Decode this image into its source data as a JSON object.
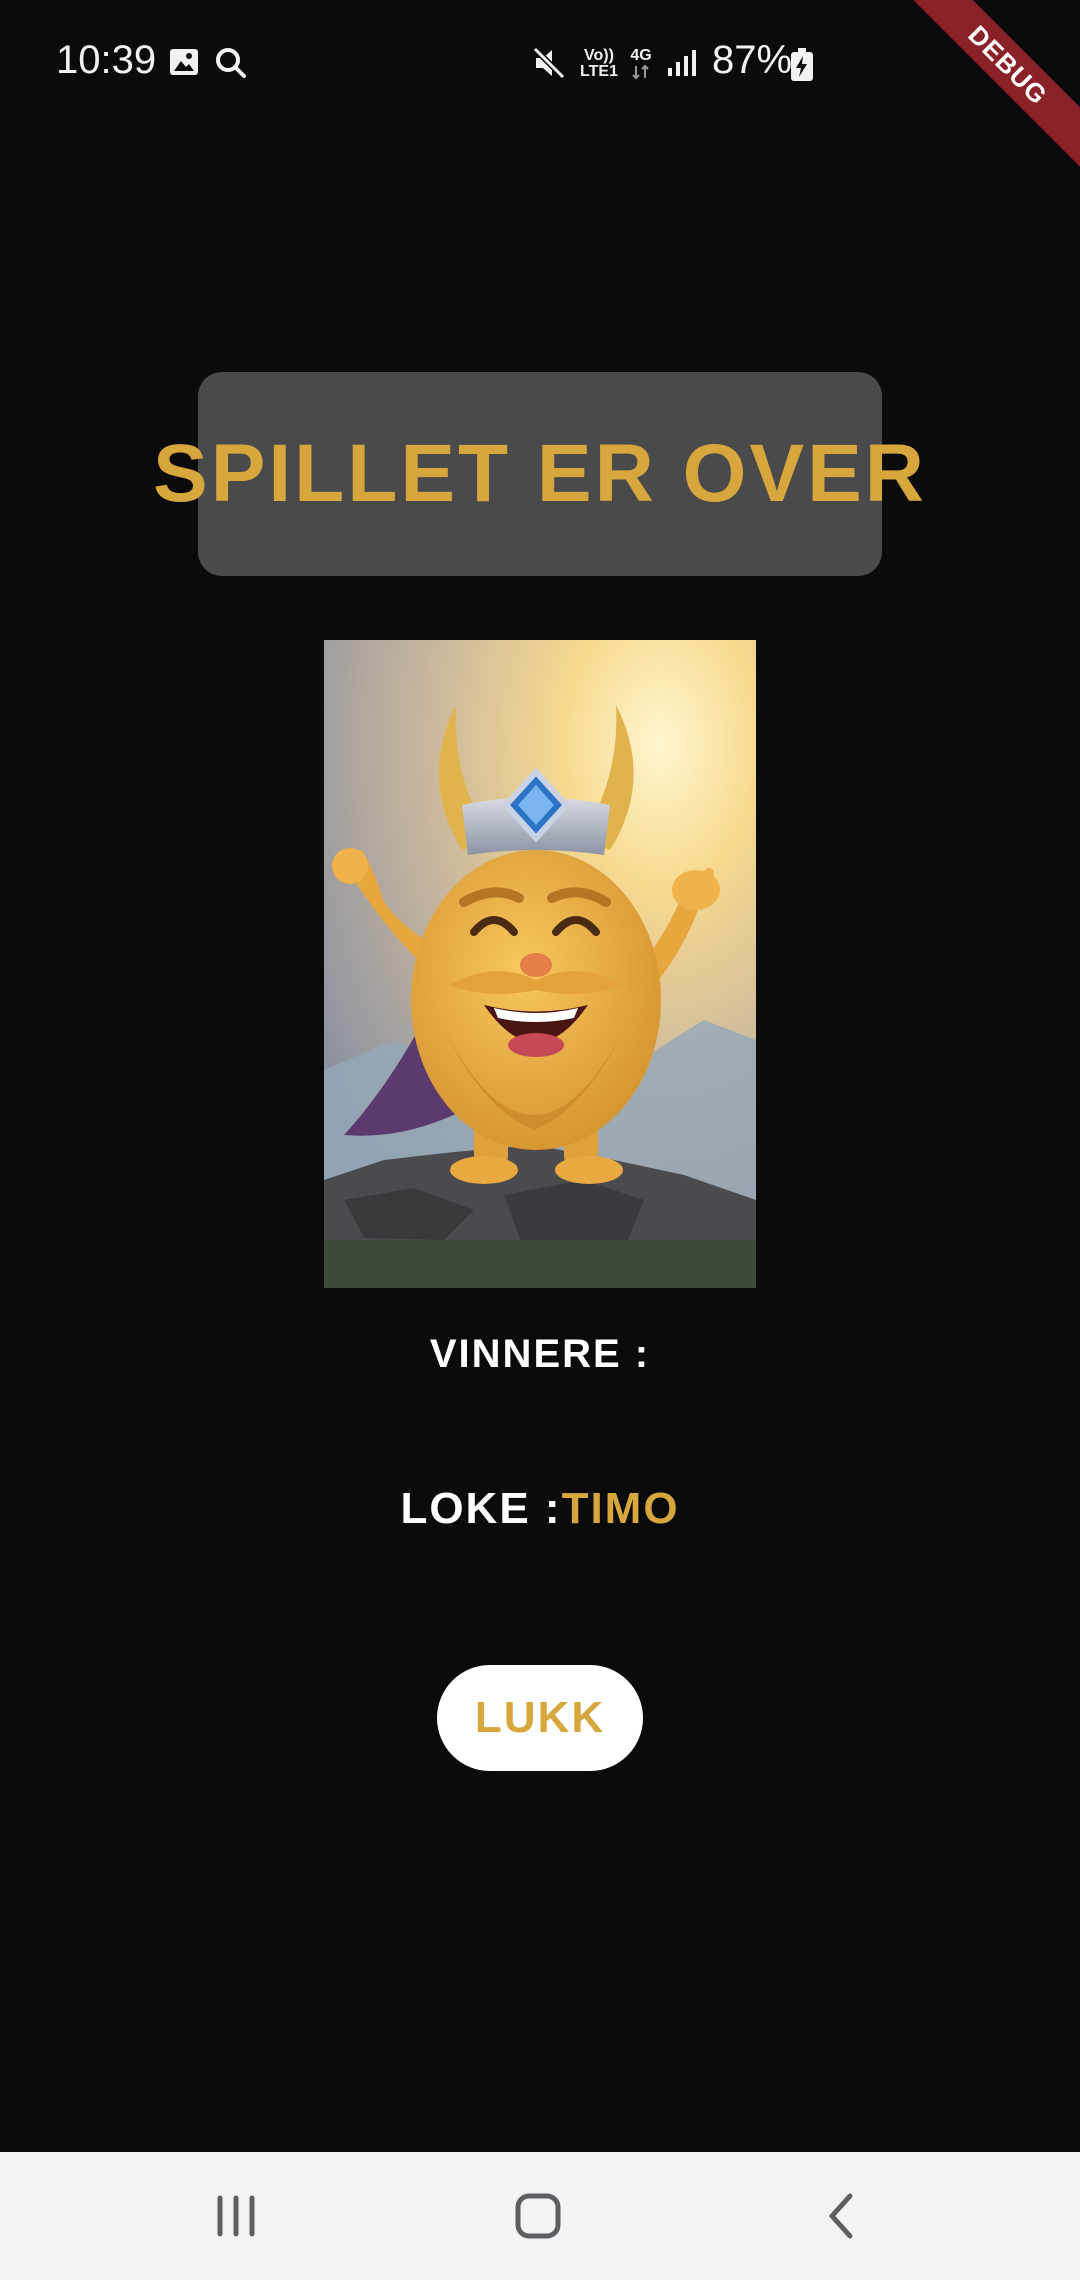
{
  "status_bar": {
    "time": "10:39",
    "battery_percent": "87%",
    "volte_top": "Vo))",
    "volte_bottom": "LTE1",
    "network_type": "4G",
    "icons": [
      "image-icon",
      "search-icon",
      "mute-icon",
      "volte-icon",
      "network-4g-icon",
      "signal-icon",
      "battery-charging-icon"
    ]
  },
  "debug_banner": "DEBUG",
  "game_over": {
    "title": "SPILLET ER OVER",
    "winners_label": "VINNERE :",
    "winner_role": "LOKE :",
    "winner_name": "TIMO",
    "close_button": "LUKK"
  },
  "nav_bar": {
    "icons": [
      "recent-apps-icon",
      "home-icon",
      "back-icon"
    ]
  },
  "colors": {
    "background": "#0b0b0c",
    "title_box": "#4a4a4b",
    "accent_gold": "#d7a73e",
    "debug_red": "#8b2128",
    "nav_bar": "#f3f3f5"
  }
}
